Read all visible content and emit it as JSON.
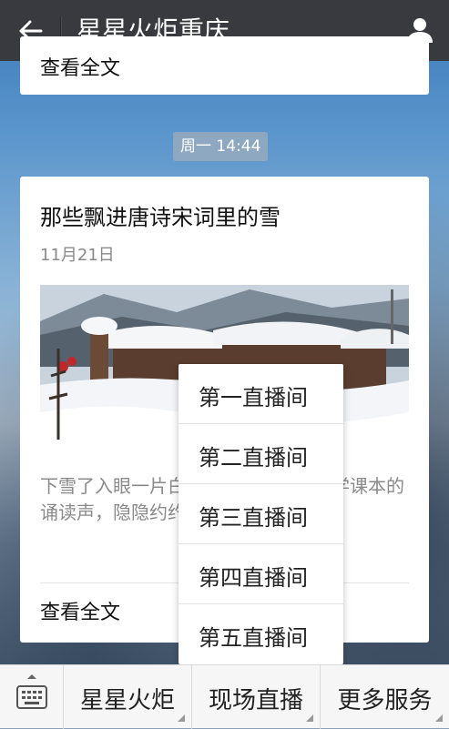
{
  "header": {
    "title": "星星火炬重庆",
    "back_icon": "back-arrow-icon",
    "user_icon": "person-icon"
  },
  "previous_card": {
    "read_full": "查看全文"
  },
  "time_badge": "周一 14:44",
  "article": {
    "title": "那些飘进唐诗宋词里的雪",
    "date": "11月21日",
    "description": "下雪了入眼一片白茫茫，耳边传来小学课本的诵读声，隐隐约约放佛昨日又似千年",
    "read_full": "查看全文"
  },
  "popup_menu": {
    "items": [
      "第一直播间",
      "第二直播间",
      "第三直播间",
      "第四直播间",
      "第五直播间"
    ]
  },
  "bottom_bar": {
    "keyboard_icon": "keyboard-icon",
    "tabs": [
      "星星火炬",
      "现场直播",
      "更多服务"
    ]
  },
  "colors": {
    "header_bg": "#393a3f",
    "bottom_bg": "#f6f6f6"
  }
}
